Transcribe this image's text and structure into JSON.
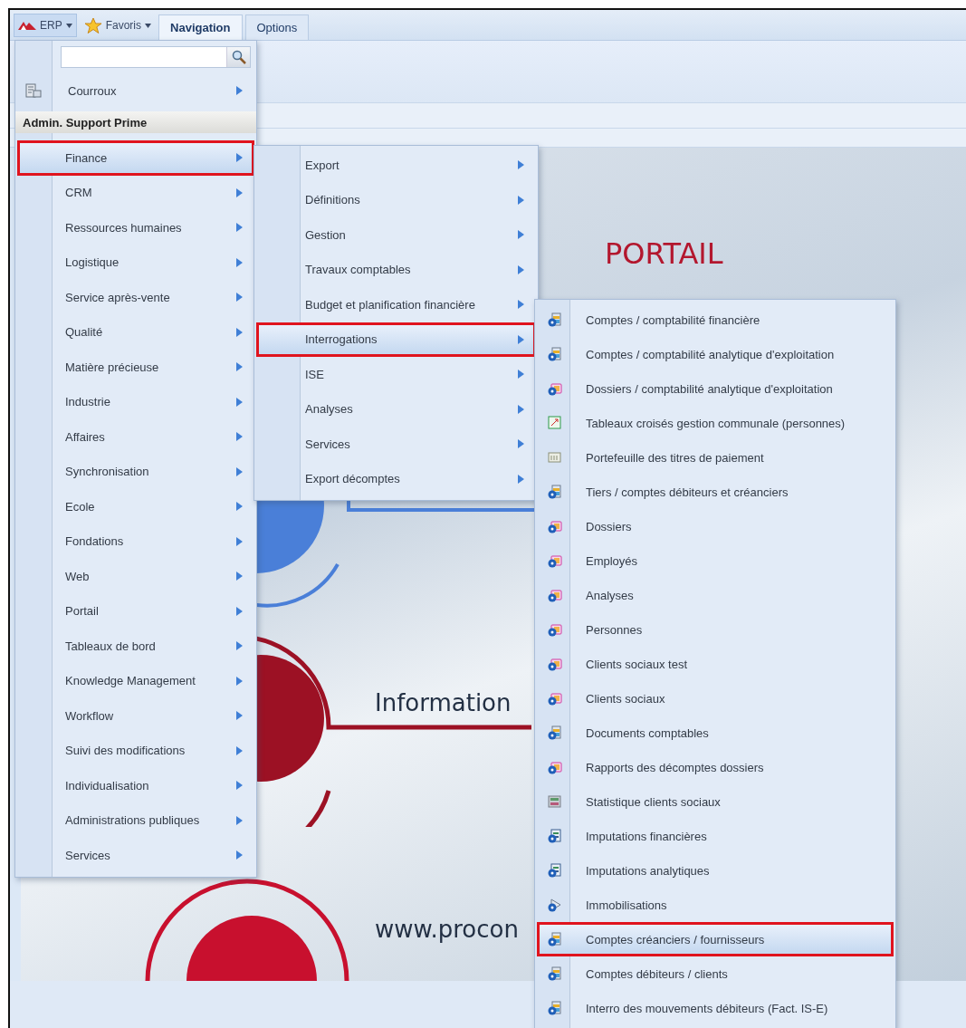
{
  "menu_buttons": [
    {
      "label": "ERP",
      "kind": "logo"
    },
    {
      "label": "Favoris",
      "kind": "star"
    }
  ],
  "tabs": [
    {
      "label": "Navigation",
      "selected": true
    },
    {
      "label": "Options",
      "selected": false
    }
  ],
  "portal": {
    "title": "PORTAIL",
    "headings": [
      "Information",
      "www.procon"
    ]
  },
  "main_menu": {
    "location": "Courroux",
    "section_header": "Admin. Support Prime",
    "items": [
      {
        "label": "Finance",
        "selected": true
      },
      {
        "label": "CRM",
        "selected": false
      },
      {
        "label": "Ressources humaines",
        "selected": false
      },
      {
        "label": "Logistique",
        "selected": false
      },
      {
        "label": "Service après-vente",
        "selected": false
      },
      {
        "label": "Qualité",
        "selected": false
      },
      {
        "label": "Matière précieuse",
        "selected": false
      },
      {
        "label": "Industrie",
        "selected": false
      },
      {
        "label": "Affaires",
        "selected": false
      },
      {
        "label": "Synchronisation",
        "selected": false
      },
      {
        "label": "Ecole",
        "selected": false
      },
      {
        "label": "Fondations",
        "selected": false
      },
      {
        "label": "Web",
        "selected": false
      },
      {
        "label": "Portail",
        "selected": false
      },
      {
        "label": "Tableaux de bord",
        "selected": false
      },
      {
        "label": "Knowledge Management",
        "selected": false
      },
      {
        "label": "Workflow",
        "selected": false
      },
      {
        "label": "Suivi des modifications",
        "selected": false
      },
      {
        "label": "Individualisation",
        "selected": false
      },
      {
        "label": "Administrations publiques",
        "selected": false
      },
      {
        "label": "Services",
        "selected": false
      }
    ]
  },
  "finance_menu": {
    "items": [
      {
        "label": "Export",
        "selected": false
      },
      {
        "label": "Définitions",
        "selected": false
      },
      {
        "label": "Gestion",
        "selected": false
      },
      {
        "label": "Travaux comptables",
        "selected": false
      },
      {
        "label": "Budget et planification financière",
        "selected": false
      },
      {
        "label": "Interrogations",
        "selected": true
      },
      {
        "label": "ISE",
        "selected": false
      },
      {
        "label": "Analyses",
        "selected": false
      },
      {
        "label": "Services",
        "selected": false
      },
      {
        "label": "Export décomptes",
        "selected": false
      }
    ]
  },
  "interrogations_menu": {
    "items": [
      {
        "label": "Comptes / comptabilité financière",
        "kind": "table",
        "selected": false
      },
      {
        "label": "Comptes / comptabilité analytique d'exploitation",
        "kind": "table",
        "selected": false
      },
      {
        "label": "Dossiers / comptabilité analytique d'exploitation",
        "kind": "folder",
        "selected": false
      },
      {
        "label": "Tableaux croisés gestion communale (personnes)",
        "kind": "crosstab",
        "selected": false
      },
      {
        "label": "Portefeuille des titres de paiement",
        "kind": "list",
        "selected": false
      },
      {
        "label": "Tiers / comptes débiteurs et créanciers",
        "kind": "table",
        "selected": false
      },
      {
        "label": "Dossiers",
        "kind": "folder",
        "selected": false
      },
      {
        "label": "Employés",
        "kind": "folder",
        "selected": false
      },
      {
        "label": "Analyses",
        "kind": "folder",
        "selected": false
      },
      {
        "label": "Personnes",
        "kind": "folder",
        "selected": false
      },
      {
        "label": "Clients sociaux test",
        "kind": "folder",
        "selected": false
      },
      {
        "label": "Clients sociaux",
        "kind": "folder",
        "selected": false
      },
      {
        "label": "Documents comptables",
        "kind": "table",
        "selected": false
      },
      {
        "label": "Rapports des décomptes dossiers",
        "kind": "folder",
        "selected": false
      },
      {
        "label": "Statistique clients sociaux",
        "kind": "stats",
        "selected": false
      },
      {
        "label": "Imputations financières",
        "kind": "form",
        "selected": false
      },
      {
        "label": "Imputations analytiques",
        "kind": "form",
        "selected": false
      },
      {
        "label": "Immobilisations",
        "kind": "asset",
        "selected": false
      },
      {
        "label": "Comptes créanciers / fournisseurs",
        "kind": "table",
        "selected": true
      },
      {
        "label": "Comptes débiteurs / clients",
        "kind": "table",
        "selected": false
      },
      {
        "label": "Interro des mouvements débiteurs (Fact. IS-E)",
        "kind": "table",
        "selected": false
      }
    ]
  }
}
